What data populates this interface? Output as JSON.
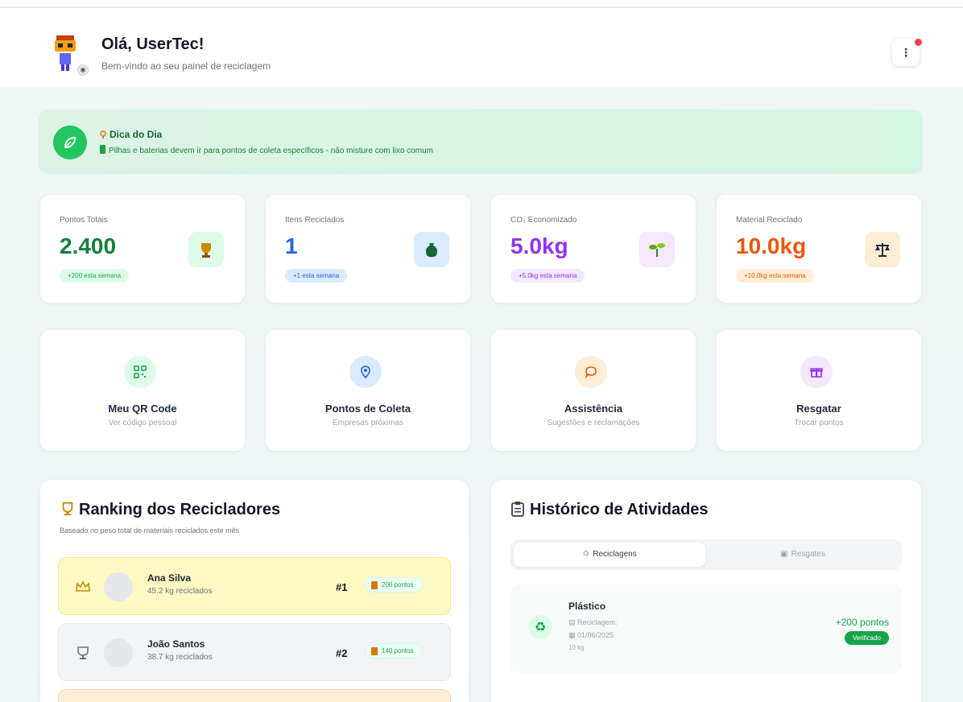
{
  "header": {
    "greeting": "Olá, UserTec!",
    "subtitle": "Bem-vindo ao seu painel de reciclagem",
    "menu_icon": "more-vertical-icon"
  },
  "tip": {
    "title": "Dica do Dia",
    "text": "Pilhas e baterias devem ir para pontos de coleta específicos - não misture com lixo comum"
  },
  "stats": [
    {
      "label": "Pontos Totais",
      "value": "2.400",
      "chip": "+200 esta semana",
      "color": "#16a34a",
      "icon": "trophy-icon"
    },
    {
      "label": "Itens Reciclados",
      "value": "1",
      "chip": "+1 esta semana",
      "color": "#2563eb",
      "icon": "recycle-bag-icon"
    },
    {
      "label": "CO₂ Economizado",
      "value": "5.0kg",
      "chip": "+5.0kg esta semana",
      "color": "#9333ea",
      "icon": "seedling-icon"
    },
    {
      "label": "Material Reciclado",
      "value": "10.0kg",
      "chip": "+10.0kg esta semana",
      "color": "#ea580c",
      "icon": "scale-icon"
    }
  ],
  "actions": [
    {
      "title": "Meu QR Code",
      "subtitle": "Ver código pessoal",
      "icon": "qr-code-icon"
    },
    {
      "title": "Pontos de Coleta",
      "subtitle": "Empresas próximas",
      "icon": "map-pin-icon"
    },
    {
      "title": "Assistência",
      "subtitle": "Sugestões e reclamações",
      "icon": "chat-bubble-icon"
    },
    {
      "title": "Resgatar",
      "subtitle": "Trocar pontos",
      "icon": "gift-icon"
    }
  ],
  "ranking": {
    "title": "Ranking dos Recicladores",
    "subtitle": "Baseado no peso total de materiais reciclados este mês",
    "entries": [
      {
        "name": "Ana Silva",
        "kg": "45.2 kg reciclados",
        "pos": "#1",
        "points": "200 pontos"
      },
      {
        "name": "João Santos",
        "kg": "38.7 kg reciclados",
        "pos": "#2",
        "points": "140 pontos"
      }
    ]
  },
  "history": {
    "title": "Histórico de Atividades",
    "tabs": [
      "Reciclagens",
      "Resgates"
    ],
    "items": [
      {
        "material": "Plástico",
        "company": "Reciclagem:",
        "date": "01/06/2025",
        "weight": "10 kg",
        "points": "+200 pontos",
        "status": "Verificado"
      }
    ]
  }
}
